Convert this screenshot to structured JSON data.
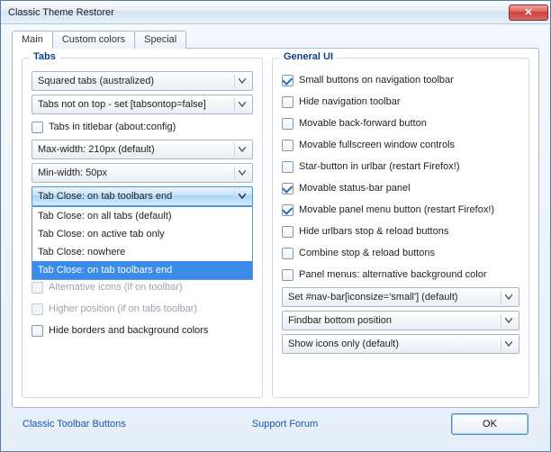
{
  "window": {
    "title": "Classic Theme Restorer"
  },
  "tabs": {
    "main": "Main",
    "custom": "Custom colors",
    "special": "Special"
  },
  "groups": {
    "tabs": "Tabs",
    "general": "General UI"
  },
  "tabsGroup": {
    "select1": "Squared tabs (australized)",
    "select2": "Tabs not on top - set [tabsontop=false]",
    "chk_titlebar": "Tabs in titlebar (about:config)",
    "select3": "Max-width: 210px (default)",
    "select4": "Min-width: 50px",
    "select5": "Tab Close: on tab toolbars end",
    "dropdown": {
      "opt0": "Tab Close: on all tabs (default)",
      "opt1": "Tab Close: on active tab only",
      "opt2": "Tab Close: nowhere",
      "opt3": "Tab Close: on tab toolbars end"
    },
    "chk_alticons": "Alternative icons (if on toolbar)",
    "chk_higherpos": "Higher position (if on tabs toolbar)",
    "chk_hideborders": "Hide borders and background colors"
  },
  "generalGroup": {
    "chk0": "Small buttons on navigation toolbar",
    "chk1": "Hide navigation toolbar",
    "chk2": "Movable back-forward button",
    "chk3": "Movable fullscreen window controls",
    "chk4": "Star-button in urlbar (restart Firefox!)",
    "chk5": "Movable status-bar panel",
    "chk6": "Movable panel menu button (restart Firefox!)",
    "chk7": "Hide urlbars stop & reload buttons",
    "chk8": "Combine stop & reload buttons",
    "chk9": "Panel menus: alternative background color",
    "select1": "Set #nav-bar[iconsize='small'] (default)",
    "select2": "Findbar bottom position",
    "select3": "Show icons only (default)"
  },
  "footer": {
    "link1": "Classic Toolbar Buttons",
    "link2": "Support Forum",
    "ok": "OK"
  }
}
